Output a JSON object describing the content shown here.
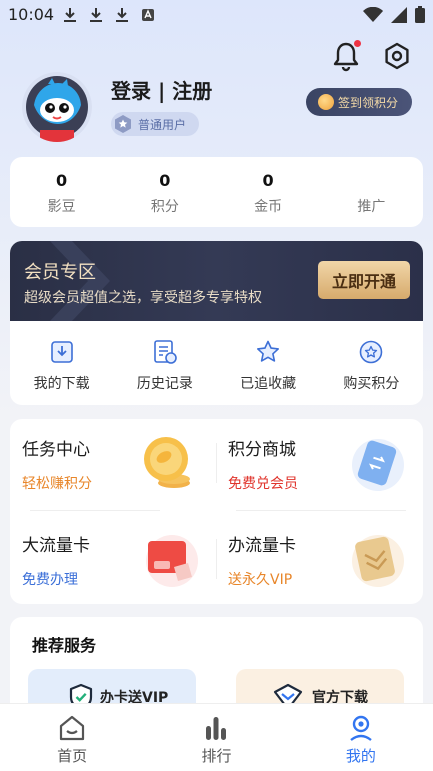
{
  "status_bar": {
    "time": "10:04"
  },
  "profile": {
    "login_label": "登录 | 注册",
    "user_level": "普通用户",
    "checkin_label": "签到领积分"
  },
  "stats": [
    {
      "value": "0",
      "label": "影豆"
    },
    {
      "value": "0",
      "label": "积分"
    },
    {
      "value": "0",
      "label": "金币"
    },
    {
      "value": "",
      "label": "推广"
    }
  ],
  "vip": {
    "title": "会员专区",
    "subtitle": "超级会员超值之选，享受超多专享特权",
    "button": "立即开通"
  },
  "quick_actions": [
    {
      "label": "我的下载",
      "icon": "download-icon"
    },
    {
      "label": "历史记录",
      "icon": "history-icon"
    },
    {
      "label": "已追收藏",
      "icon": "star-icon"
    },
    {
      "label": "购买积分",
      "icon": "buy-points-icon"
    }
  ],
  "tasks": [
    {
      "title": "任务中心",
      "subtitle": "轻松赚积分",
      "color": "#e8862a"
    },
    {
      "title": "积分商城",
      "subtitle": "免费兑会员",
      "color": "#e0342c"
    },
    {
      "title": "大流量卡",
      "subtitle": "免费办理",
      "color": "#3b6fd8"
    },
    {
      "title": "办流量卡",
      "subtitle": "送永久VIP",
      "color": "#e8862a"
    }
  ],
  "recommend": {
    "title": "推荐服务",
    "items": [
      "办卡送VIP",
      "官方下载"
    ]
  },
  "tabs": [
    {
      "label": "首页",
      "active": false
    },
    {
      "label": "排行",
      "active": false
    },
    {
      "label": "我的",
      "active": true
    }
  ],
  "colors": {
    "accent": "#3275f0",
    "tab_inactive": "#555555"
  }
}
